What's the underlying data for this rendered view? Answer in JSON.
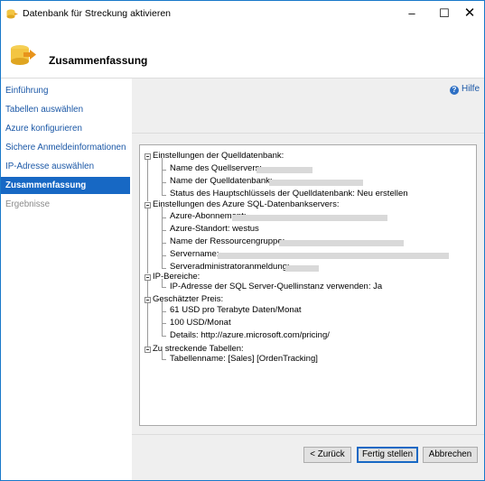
{
  "window": {
    "title": "Datenbank für Streckung aktivieren",
    "controls": {
      "minimize": "–",
      "maximize": "☐",
      "close": "✕"
    }
  },
  "header": {
    "title": "Zusammenfassung"
  },
  "nav": {
    "items": [
      {
        "label": "Einführung",
        "state": "link"
      },
      {
        "label": "Tabellen auswählen",
        "state": "link"
      },
      {
        "label": "Azure konfigurieren",
        "state": "link"
      },
      {
        "label": "Sichere Anmeldeinformationen",
        "state": "link"
      },
      {
        "label": "IP-Adresse auswählen",
        "state": "link"
      },
      {
        "label": "Zusammenfassung",
        "state": "active"
      },
      {
        "label": "Ergebnisse",
        "state": "disabled"
      }
    ]
  },
  "help": {
    "label": "Hilfe",
    "icon": "help-icon"
  },
  "summary": {
    "source": {
      "heading": "Einstellungen der Quelldatenbank:",
      "server_name": "Name des Quellservers:",
      "db_name": "Name der Quelldatenbank:",
      "master_key": "Status des Hauptschlüssels der Quelldatenbank: Neu erstellen"
    },
    "azure": {
      "heading": "Einstellungen des Azure SQL-Datenbankservers:",
      "subscription": "Azure-Abonnement:",
      "location": "Azure-Standort: westus",
      "resource_group": "Name der Ressourcengruppe:",
      "server_name": "Servername:",
      "admin_login": "Serveradministratoranmeldung:"
    },
    "ip": {
      "heading": "IP-Bereiche:",
      "use_source_ip": "IP-Adresse der SQL Server-Quellinstanz verwenden: Ja"
    },
    "price": {
      "heading": "Geschätzter Preis:",
      "storage": "61 USD pro Terabyte Daten/Monat",
      "compute": "100 USD/Monat",
      "details": "Details: http://azure.microsoft.com/pricing/"
    },
    "tables": {
      "heading": "Zu streckende Tabellen:",
      "table_name": "Tabellenname: [Sales] [OrdenTracking]"
    }
  },
  "buttons": {
    "back": "< Zurück",
    "finish": "Fertig stellen",
    "cancel": "Abbrechen"
  },
  "colors": {
    "accent": "#1768c4",
    "link": "#1a57a6",
    "window_border": "#1979ca",
    "content_bg": "#efefef"
  }
}
